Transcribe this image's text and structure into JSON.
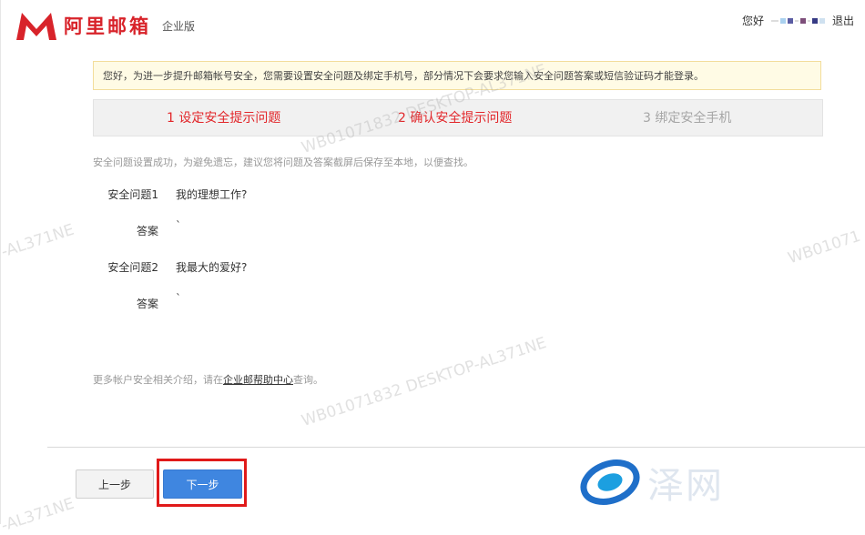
{
  "header": {
    "logo_text": "阿里邮箱",
    "edition": "企业版",
    "greeting": "您好",
    "logout": "退出",
    "colors": {
      "brand": "#d8232a"
    }
  },
  "notice": "您好，为进一步提升邮箱帐号安全，您需要设置安全问题及绑定手机号，部分情况下会要求您输入安全问题答案或短信验证码才能登录。",
  "steps": [
    {
      "label": "1 设定安全提示问题",
      "state": "active"
    },
    {
      "label": "2 确认安全提示问题",
      "state": "active"
    },
    {
      "label": "3 绑定安全手机",
      "state": "inactive"
    }
  ],
  "tip": "安全问题设置成功，为避免遗忘，建议您将问题及答案截屏后保存至本地，以便查找。",
  "questions": [
    {
      "label": "安全问题1",
      "value": "我的理想工作?"
    },
    {
      "label": "答案",
      "value": "`"
    },
    {
      "label": "安全问题2",
      "value": "我最大的爱好?"
    },
    {
      "label": "答案",
      "value": "`"
    }
  ],
  "help": {
    "prefix": "更多帐户安全相关介绍，请在",
    "link": "企业邮帮助中心",
    "suffix": "查询。"
  },
  "buttons": {
    "prev": "上一步",
    "next": "下一步"
  },
  "watermark": {
    "full": "WB01071832 DESKTOP-AL371NE",
    "partial_left": "-AL371NE",
    "partial_right": "WB01071"
  },
  "brand": {
    "text": "泽网"
  }
}
